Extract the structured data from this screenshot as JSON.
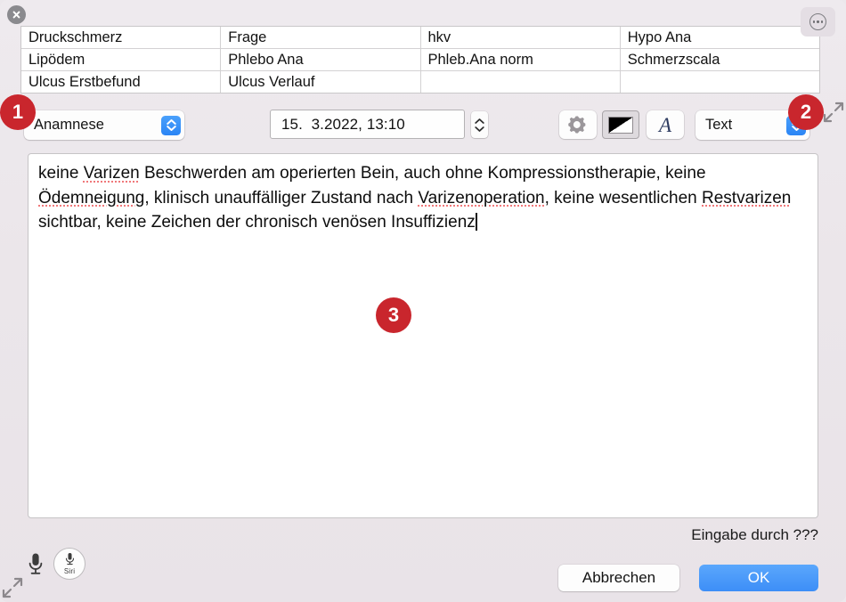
{
  "window": {
    "close_icon": "close-circle-icon",
    "more_icon": "ellipsis-circle-icon"
  },
  "grid": {
    "rows": [
      [
        "Druckschmerz",
        "Frage",
        "hkv",
        "Hypo Ana"
      ],
      [
        "Lipödem",
        "Phlebo Ana",
        "Phleb.Ana norm",
        "Schmerzscala"
      ],
      [
        "Ulcus Erstbefund",
        "Ulcus Verlauf",
        "",
        ""
      ]
    ]
  },
  "toolbar": {
    "category_popup": "Anamnese",
    "date_value": "15.  3.2022, 13:10",
    "gear_icon": "gear-icon",
    "color_icon": "color-swatch-icon",
    "font_icon": "font-A-icon",
    "type_popup": "Text"
  },
  "editor": {
    "segments": [
      {
        "text": "keine ",
        "misspelled": false
      },
      {
        "text": "Varizen",
        "misspelled": true
      },
      {
        "text": " Beschwerden am operierten Bein, auch ohne Kompressionstherapie, keine ",
        "misspelled": false
      },
      {
        "text": "Ödemneigung",
        "misspelled": true
      },
      {
        "text": ", klinisch unauffälliger Zustand nach ",
        "misspelled": false
      },
      {
        "text": "Varizenoperation",
        "misspelled": true
      },
      {
        "text": ", keine wesentlichen ",
        "misspelled": false
      },
      {
        "text": "Restvarizen",
        "misspelled": true
      },
      {
        "text": " sichtbar, keine Zeichen der chronisch venösen Insuffizienz",
        "misspelled": false
      }
    ],
    "full_text": "keine Varizen Beschwerden am operierten Bein, auch ohne Kompressionstherapie, keine Ödemneigung, klinisch unauffälliger Zustand nach Varizenoperation, keine wesentlichen Restvarizen sichtbar, keine Zeichen der chronisch venösen Insuffizienz"
  },
  "footer": {
    "entered_by": "Eingabe durch ???",
    "mic_icon": "microphone-icon",
    "siri_icon": "siri-microphone-icon",
    "siri_label": "Siri",
    "cancel_label": "Abbrechen",
    "ok_label": "OK"
  },
  "annotations": [
    {
      "id": "1",
      "label": "1"
    },
    {
      "id": "2",
      "label": "2"
    },
    {
      "id": "3",
      "label": "3"
    }
  ],
  "colors": {
    "accent_blue": "#3d8ef7",
    "badge_red": "#c9262d",
    "spellcheck_red": "#f0787a",
    "window_bg": "#ebe6ea"
  }
}
